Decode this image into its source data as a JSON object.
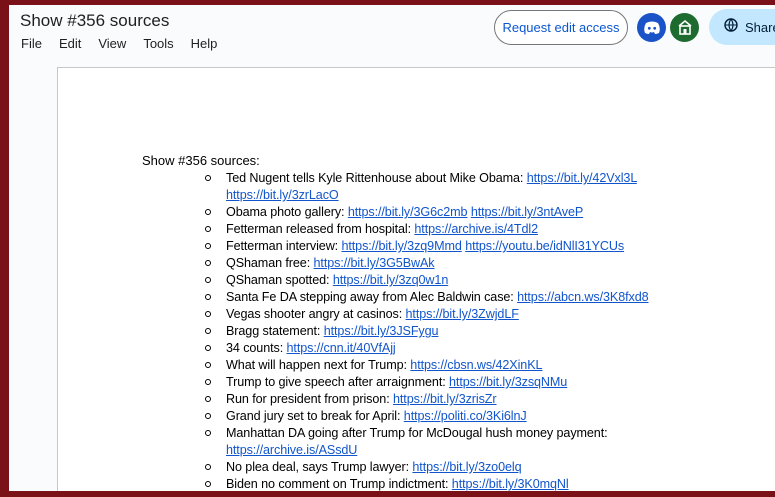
{
  "document": {
    "title": "Show #356 sources"
  },
  "menu": [
    "File",
    "Edit",
    "View",
    "Tools",
    "Help"
  ],
  "header": {
    "request_edit_label": "Request edit access",
    "share_label": "Share"
  },
  "colors": {
    "frame": "#7a1118",
    "link": "#1155cc",
    "share_bg": "#c2e7ff",
    "discord": "#1a52c7",
    "cbox": "#1e6b30"
  },
  "icons": [
    "discord-icon",
    "cbox-icon",
    "globe-icon"
  ],
  "content": {
    "heading": "Show #356 sources:",
    "items": [
      {
        "text": "Ted Nugent tells Kyle Rittenhouse about Mike Obama: ",
        "links": [
          "https://bit.ly/42Vxl3L",
          "https://bit.ly/3zrLacO"
        ]
      },
      {
        "text": "Obama photo gallery: ",
        "links": [
          "https://bit.ly/3G6c2mb",
          "https://bit.ly/3ntAveP"
        ]
      },
      {
        "text": "Fetterman released from hospital: ",
        "links": [
          "https://archive.is/4Tdl2"
        ]
      },
      {
        "text": "Fetterman interview: ",
        "links": [
          "https://bit.ly/3zq9Mmd",
          "https://youtu.be/idNlI31YCUs"
        ]
      },
      {
        "text": "QShaman free: ",
        "links": [
          "https://bit.ly/3G5BwAk"
        ]
      },
      {
        "text": "QShaman spotted: ",
        "links": [
          "https://bit.ly/3zq0w1n"
        ]
      },
      {
        "text": "Santa Fe DA stepping away from Alec Baldwin case: ",
        "links": [
          "https://abcn.ws/3K8fxd8"
        ]
      },
      {
        "text": "Vegas shooter angry at casinos: ",
        "links": [
          "https://bit.ly/3ZwjdLF"
        ]
      },
      {
        "text": "Bragg statement: ",
        "links": [
          "https://bit.ly/3JSFygu"
        ]
      },
      {
        "text": "34 counts: ",
        "links": [
          "https://cnn.it/40VfAjj"
        ]
      },
      {
        "text": "What will happen next for Trump: ",
        "links": [
          "https://cbsn.ws/42XinKL"
        ]
      },
      {
        "text": "Trump to give speech after arraignment: ",
        "links": [
          "https://bit.ly/3zsqNMu"
        ]
      },
      {
        "text": "Run for president from prison: ",
        "links": [
          "https://bit.ly/3zrisZr"
        ]
      },
      {
        "text": "Grand jury set to break for April: ",
        "links": [
          "https://politi.co/3Ki6lnJ"
        ]
      },
      {
        "text": "Manhattan DA going after Trump for McDougal  hush money payment: ",
        "links": [
          "https://archive.is/ASsdU"
        ]
      },
      {
        "text": "No plea deal, says Trump lawyer: ",
        "links": [
          "https://bit.ly/3zo0elq"
        ]
      },
      {
        "text": "Biden no comment on Trump indictment: ",
        "links": [
          "https://bit.ly/3K0mqNl"
        ]
      }
    ]
  }
}
